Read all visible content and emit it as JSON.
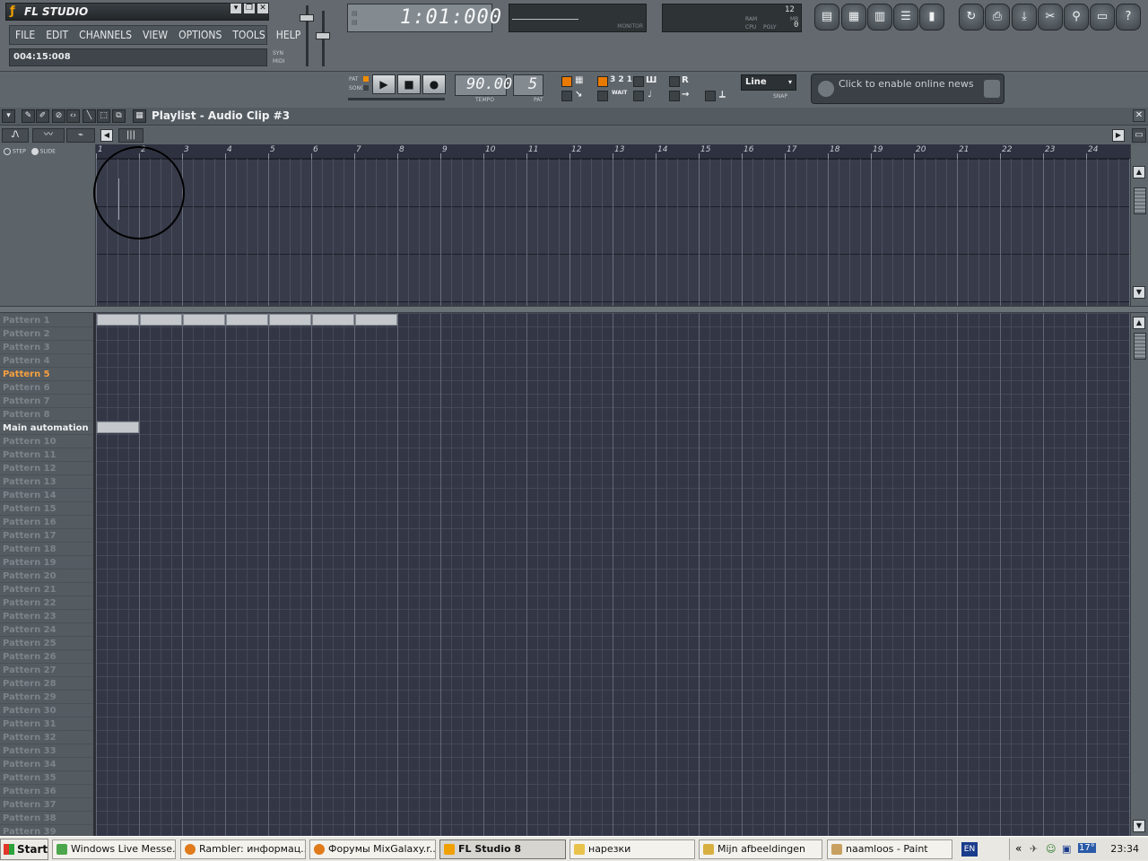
{
  "app": {
    "title": "FL STUDIO",
    "menu": [
      "FILE",
      "EDIT",
      "CHANNELS",
      "VIEW",
      "OPTIONS",
      "TOOLS",
      "HELP"
    ],
    "hint": "004:15:008",
    "sync_labels": [
      "SYN",
      "MIDI"
    ]
  },
  "time_display": "1:01:000",
  "monitor_label": "MONITOR",
  "cpu": {
    "top_right": "12",
    "ram_label": "RAM",
    "cpu_label": "CPU",
    "poly_label": "POLY",
    "poly_val": "0",
    "mb_label": "MB"
  },
  "transport": {
    "pat_label": "PAT",
    "song_label": "SONG",
    "tempo": "90.000",
    "tempo_label": "TEMPO",
    "pattern": "5",
    "pattern_label": "PAT"
  },
  "snap": {
    "value": "Line",
    "label": "SNAP",
    "count_glyph": "3 2 1",
    "wait_label": "WAIT"
  },
  "news": {
    "text": "Click to enable online news"
  },
  "playlist": {
    "title": "Playlist - Audio Clip #3",
    "step_label": "STEP",
    "slide_label": "SLIDE",
    "ruler": [
      "1",
      "2",
      "3",
      "4",
      "5",
      "6",
      "7",
      "8",
      "9",
      "10",
      "11",
      "12",
      "13",
      "14",
      "15",
      "16",
      "17",
      "18",
      "19",
      "20",
      "21",
      "22",
      "23",
      "24"
    ],
    "patterns": [
      "Pattern 1",
      "Pattern 2",
      "Pattern 3",
      "Pattern 4",
      "Pattern 5",
      "Pattern 6",
      "Pattern 7",
      "Pattern 8",
      "Main automation",
      "Pattern 10",
      "Pattern 11",
      "Pattern 12",
      "Pattern 13",
      "Pattern 14",
      "Pattern 15",
      "Pattern 16",
      "Pattern 17",
      "Pattern 18",
      "Pattern 19",
      "Pattern 20",
      "Pattern 21",
      "Pattern 22",
      "Pattern 23",
      "Pattern 24",
      "Pattern 25",
      "Pattern 26",
      "Pattern 27",
      "Pattern 28",
      "Pattern 29",
      "Pattern 30",
      "Pattern 31",
      "Pattern 32",
      "Pattern 33",
      "Pattern 34",
      "Pattern 35",
      "Pattern 36",
      "Pattern 37",
      "Pattern 38",
      "Pattern 39"
    ],
    "active_pattern": "Pattern 5"
  },
  "taskbar": {
    "start": "Start",
    "tasks": [
      "Windows Live Messe...",
      "Rambler: информац...",
      "Форумы MixGalaxy.r...",
      "FL Studio 8",
      "нарезки",
      "Mijn afbeeldingen",
      "naamloos - Paint"
    ],
    "active_task": "FL Studio 8",
    "lang": "EN",
    "clock": "23:34",
    "temp": "17°"
  },
  "colors": {
    "accent": "#f08c00",
    "grid_bg": "#333645",
    "active_pattern": "#f5a040"
  }
}
